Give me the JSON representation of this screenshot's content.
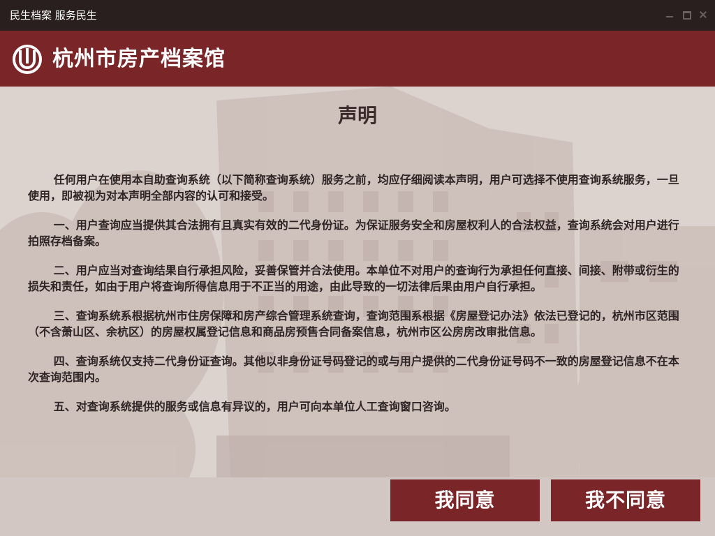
{
  "window": {
    "title": "民生档案 服务民生"
  },
  "header": {
    "org_name": "杭州市房产档案馆",
    "logo_icon": "u-arc-logo-icon",
    "brand_color": "#7a2528"
  },
  "statement": {
    "title": "声明",
    "paragraphs": [
      "任何用户在使用本自助查询系统（以下简称查询系统）服务之前，均应仔细阅读本声明，用户可选择不使用查询系统服务，一旦使用，即被视为对本声明全部内容的认可和接受。",
      "一、用户查询应当提供其合法拥有且真实有效的二代身份证。为保证服务安全和房屋权利人的合法权益，查询系统会对用户进行拍照存档备案。",
      "二、用户应当对查询结果自行承担风险，妥善保管并合法使用。本单位不对用户的查询行为承担任何直接、间接、附带或衍生的损失和责任，如由于用户将查询所得信息用于不正当的用途，由此导致的一切法律后果由用户自行承担。",
      "三、查询系统系根据杭州市住房保障和房产综合管理系统查询，查询范围系根据《房屋登记办法》依法已登记的，杭州市区范围（不含萧山区、余杭区）的房屋权属登记信息和商品房预售合同备案信息，杭州市区公房房改审批信息。",
      "四、查询系统仅支持二代身份证查询。其他以非身份证号码登记的或与用户提供的二代身份证号码不一致的房屋登记信息不在本次查询范围内。",
      "五、对查询系统提供的服务或信息有异议的，用户可向本单位人工查询窗口咨询。"
    ]
  },
  "actions": {
    "agree_label": "我同意",
    "disagree_label": "我不同意"
  }
}
